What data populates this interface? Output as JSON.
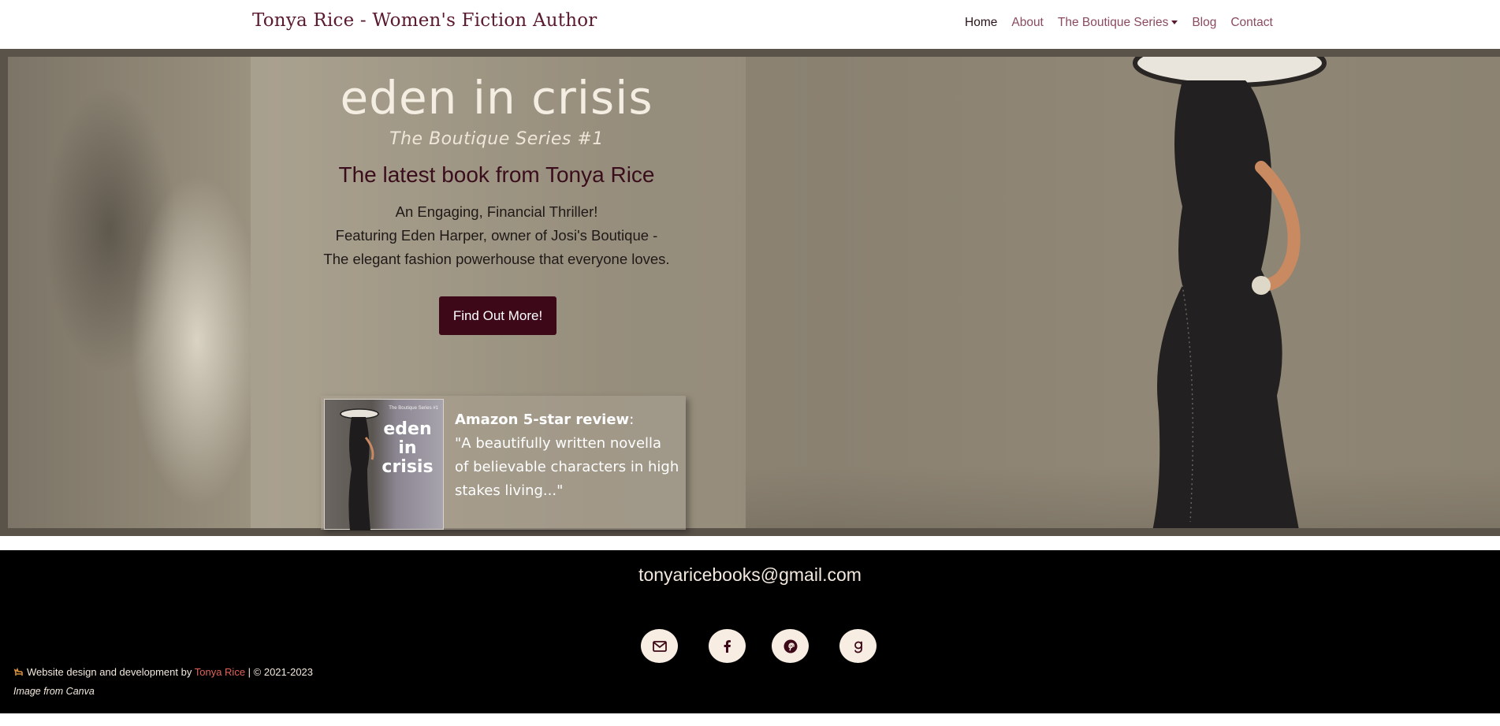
{
  "navbar": {
    "brand": "Tonya Rice - Women's Fiction Author",
    "links": [
      {
        "label": "Home"
      },
      {
        "label": "About"
      },
      {
        "label": "The Boutique Series"
      },
      {
        "label": "Blog"
      },
      {
        "label": "Contact"
      }
    ]
  },
  "hero": {
    "title": "eden in crisis",
    "subtitle": "The Boutique Series #1",
    "heading": "The latest book from Tonya Rice",
    "lines": [
      "An Engaging, Financial Thriller!",
      "Featuring Eden Harper, owner of Josi's Boutique -",
      "The elegant fashion powerhouse that everyone loves."
    ],
    "cta_label": "Find Out More!",
    "review": {
      "cover_series": "The Boutique Series #1",
      "cover_title": "eden in crisis",
      "label": "Amazon 5-star review",
      "colon": ":",
      "quote": "\"A beautifully written novella of believable characters in high stakes living...\""
    }
  },
  "footer": {
    "email": "tonyaricebooks@gmail.com",
    "socials": [
      "envelope-icon",
      "facebook-icon",
      "pinterest-icon",
      "goodreads-icon"
    ],
    "credit_prefix": "Website design and development by",
    "credit_name": "Tonya Rice",
    "credit_suffix": "| © 2021-2023",
    "image_credit": "Image from Canva"
  },
  "colors": {
    "brand": "#5a1a2e",
    "cta_bg": "#3d0818",
    "footer_bg": "#000000",
    "credit_link": "#e0645a"
  }
}
